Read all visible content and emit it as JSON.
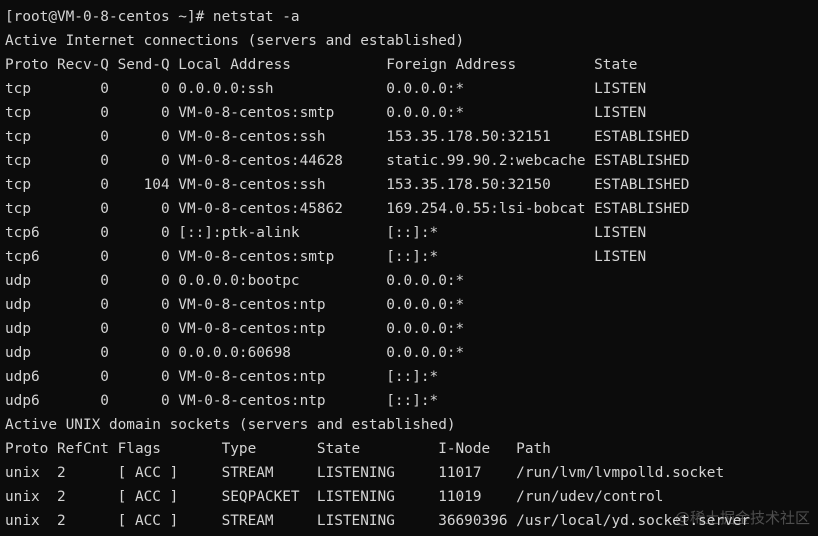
{
  "terminal": {
    "lines": [
      "[root@VM-0-8-centos ~]# netstat -a",
      "Active Internet connections (servers and established)",
      "Proto Recv-Q Send-Q Local Address           Foreign Address         State",
      "tcp        0      0 0.0.0.0:ssh             0.0.0.0:*               LISTEN",
      "tcp        0      0 VM-0-8-centos:smtp      0.0.0.0:*               LISTEN",
      "tcp        0      0 VM-0-8-centos:ssh       153.35.178.50:32151     ESTABLISHED",
      "tcp        0      0 VM-0-8-centos:44628     static.99.90.2:webcache ESTABLISHED",
      "tcp        0    104 VM-0-8-centos:ssh       153.35.178.50:32150     ESTABLISHED",
      "tcp        0      0 VM-0-8-centos:45862     169.254.0.55:lsi-bobcat ESTABLISHED",
      "tcp6       0      0 [::]:ptk-alink          [::]:*                  LISTEN",
      "tcp6       0      0 VM-0-8-centos:smtp      [::]:*                  LISTEN",
      "udp        0      0 0.0.0.0:bootpc          0.0.0.0:*",
      "udp        0      0 VM-0-8-centos:ntp       0.0.0.0:*",
      "udp        0      0 VM-0-8-centos:ntp       0.0.0.0:*",
      "udp        0      0 0.0.0.0:60698           0.0.0.0:*",
      "udp6       0      0 VM-0-8-centos:ntp       [::]:*",
      "udp6       0      0 VM-0-8-centos:ntp       [::]:*",
      "Active UNIX domain sockets (servers and established)",
      "Proto RefCnt Flags       Type       State         I-Node   Path",
      "unix  2      [ ACC ]     STREAM     LISTENING     11017    /run/lvm/lvmpolld.socket",
      "unix  2      [ ACC ]     SEQPACKET  LISTENING     11019    /run/udev/control",
      "unix  2      [ ACC ]     STREAM     LISTENING     36690396 /usr/local/yd.socket.server"
    ]
  },
  "watermark": {
    "text": "@稀土掘金技术社区"
  },
  "colors": {
    "background": "#0c0c0c",
    "foreground": "#d4d4d4"
  }
}
